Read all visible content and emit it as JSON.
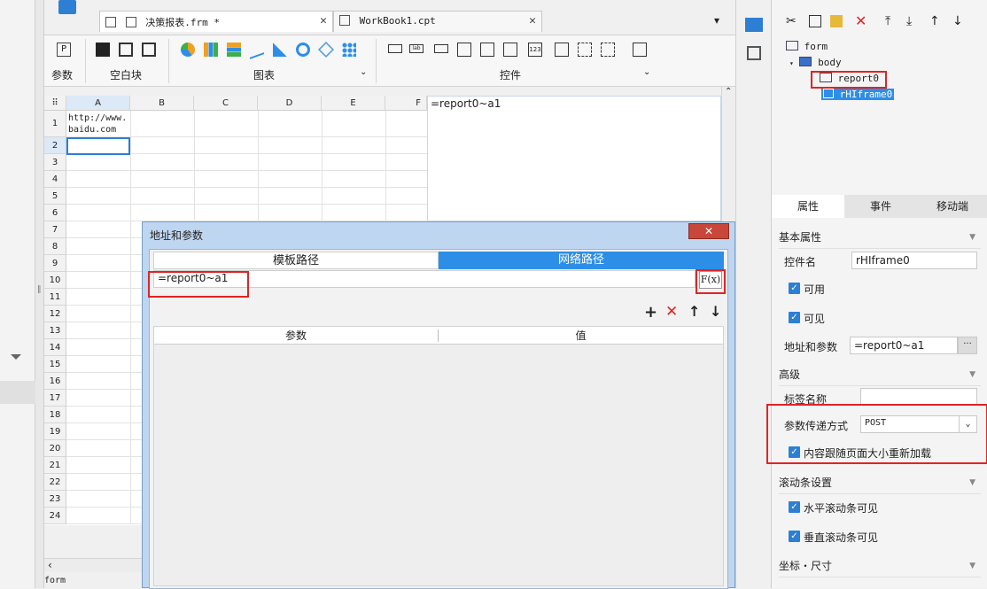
{
  "tabs": [
    {
      "label": "决策报表.frm *",
      "active": true
    },
    {
      "label": "WorkBook1.cpt",
      "active": false
    }
  ],
  "ribbon": {
    "groups": [
      {
        "label": "参数"
      },
      {
        "label": "空白块"
      },
      {
        "label": "图表"
      },
      {
        "label": "控件"
      }
    ]
  },
  "sheet": {
    "columns": [
      "A",
      "B",
      "C",
      "D",
      "E",
      "F"
    ],
    "rows": [
      "1",
      "2",
      "3",
      "4",
      "5",
      "6",
      "7",
      "8",
      "9",
      "10",
      "11",
      "12",
      "13",
      "14",
      "15",
      "16",
      "17",
      "18",
      "19",
      "20",
      "21",
      "22",
      "23",
      "24"
    ],
    "cell_a1": "http://www.baidu.com"
  },
  "preview": {
    "formula": "=report0~a1"
  },
  "status_bar": {
    "text": "form"
  },
  "tree": {
    "items": [
      "form",
      "body",
      "report0",
      "rHIframe0"
    ]
  },
  "props": {
    "tabs": [
      "属性",
      "事件",
      "移动端"
    ],
    "basic_section": "基本属性",
    "name_label": "控件名",
    "name_value": "rHIframe0",
    "enabled_label": "可用",
    "visible_label": "可见",
    "address_label": "地址和参数",
    "address_value": "=report0~a1",
    "advanced_section": "高级",
    "tag_label": "标签名称",
    "method_label": "参数传递方式",
    "method_value": "POST",
    "reload_label": "内容跟随页面大小重新加载",
    "scroll_section": "滚动条设置",
    "hscroll_label": "水平滚动条可见",
    "vscroll_label": "垂直滚动条可见",
    "coord_section": "坐标・尺寸"
  },
  "dialog": {
    "title": "地址和参数",
    "tab_template": "模板路径",
    "tab_network": "网络路径",
    "path_value": "=report0~a1",
    "fx_label": "F(x)",
    "col_param": "参数",
    "col_value": "值"
  },
  "colors": {
    "accent": "#2d8ee8",
    "highlight": "#e02424"
  }
}
